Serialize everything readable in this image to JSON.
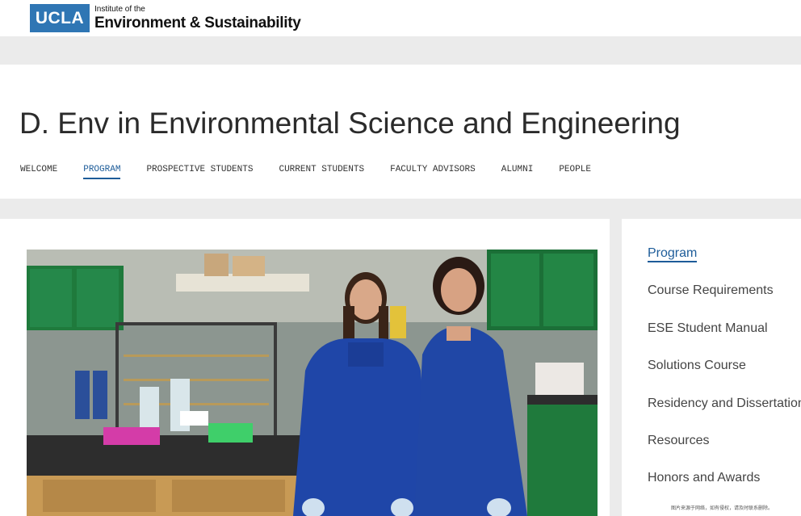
{
  "logo": {
    "mark": "UCLA",
    "subtitle": "Institute of the",
    "name": "Environment & Sustainability"
  },
  "page": {
    "title": "D. Env in Environmental Science and Engineering"
  },
  "tabs": [
    {
      "label": "WELCOME",
      "active": false
    },
    {
      "label": "PROGRAM",
      "active": true
    },
    {
      "label": "PROSPECTIVE STUDENTS",
      "active": false
    },
    {
      "label": "CURRENT STUDENTS",
      "active": false
    },
    {
      "label": "FACULTY ADVISORS",
      "active": false
    },
    {
      "label": "ALUMNI",
      "active": false
    },
    {
      "label": "PEOPLE",
      "active": false
    }
  ],
  "sidebar": {
    "items": [
      {
        "label": "Program",
        "active": true
      },
      {
        "label": "Course Requirements",
        "active": false
      },
      {
        "label": "ESE Student Manual",
        "active": false
      },
      {
        "label": "Solutions Course",
        "active": false
      },
      {
        "label": "Residency and Dissertation",
        "active": false
      },
      {
        "label": "Resources",
        "active": false
      },
      {
        "label": "Honors and Awards",
        "active": false
      }
    ]
  },
  "watermark": "图片来源于网络，如有侵权，请及时联系删除。",
  "colors": {
    "brand_blue": "#2f76b4",
    "active_link": "#1d5c99",
    "background_grey": "#ebebeb"
  }
}
